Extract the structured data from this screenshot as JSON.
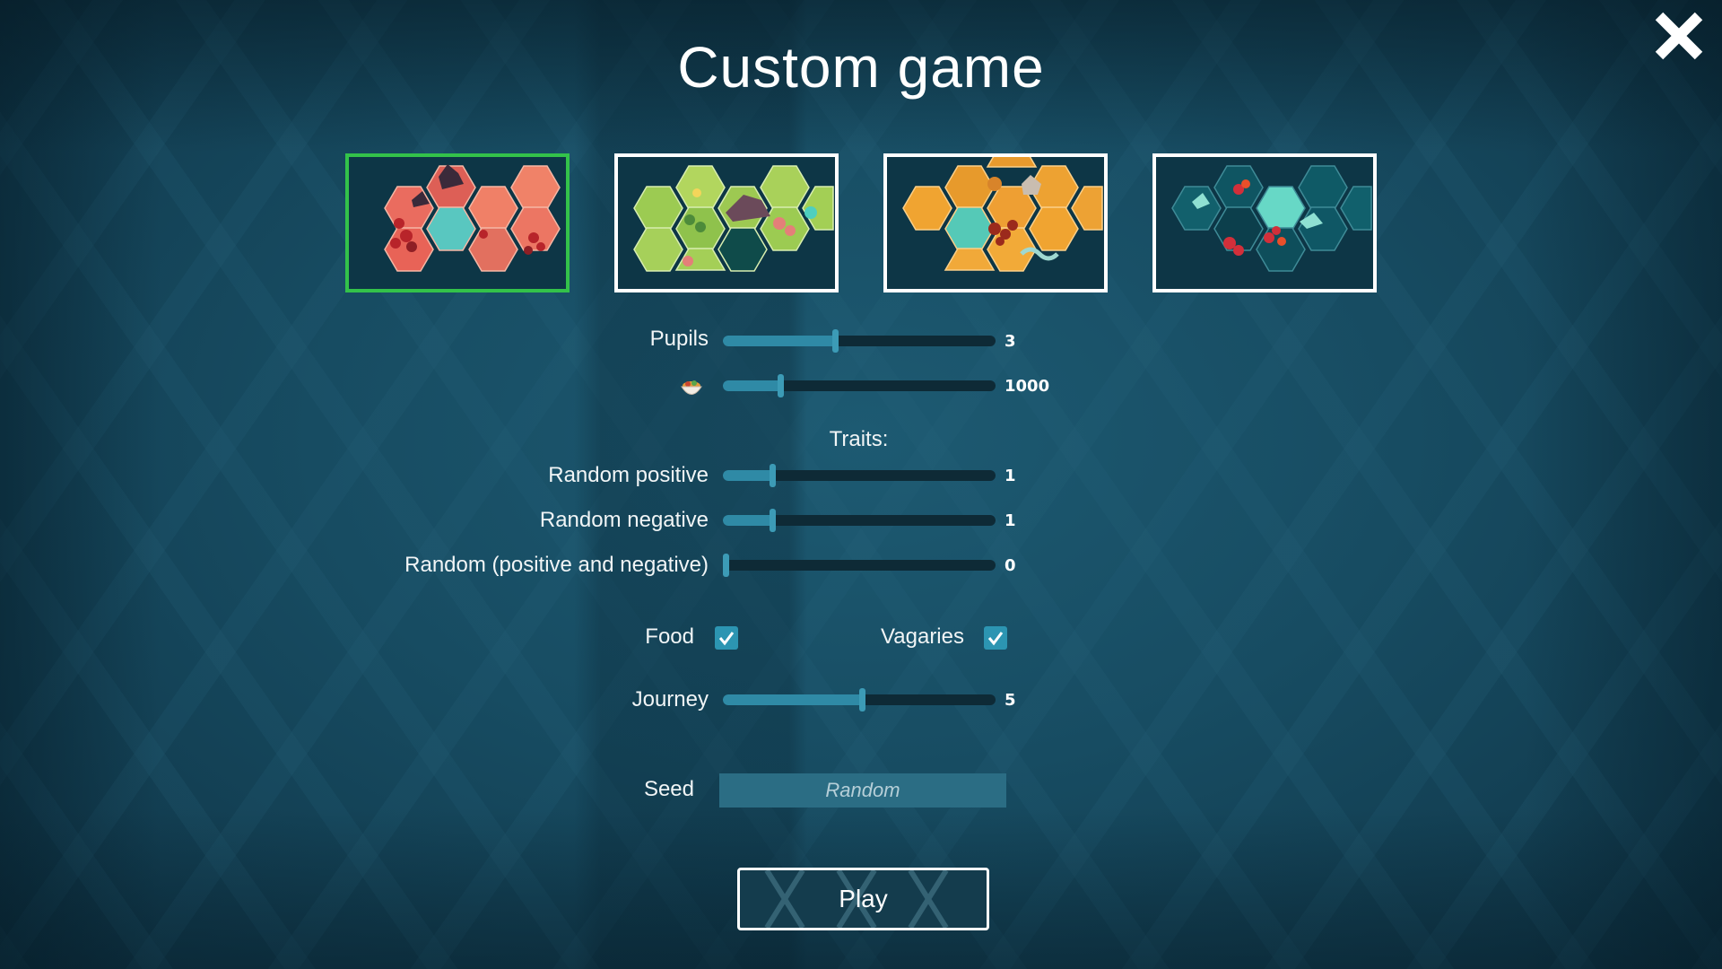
{
  "title": "Custom game",
  "close_icon": "close-icon",
  "maps": [
    {
      "name": "autumn-red-map",
      "selected": true,
      "palette": "#e8685a"
    },
    {
      "name": "green-meadow-map",
      "selected": false,
      "palette": "#9ccb52"
    },
    {
      "name": "orange-desert-map",
      "selected": false,
      "palette": "#f0a431"
    },
    {
      "name": "teal-ocean-map",
      "selected": false,
      "palette": "#0f5e6e"
    }
  ],
  "sliders": {
    "pupils": {
      "label": "Pupils",
      "value": "3",
      "fraction": 0.41
    },
    "food_amount": {
      "icon": "food-bowl-icon",
      "value": "1000",
      "fraction": 0.21
    },
    "traits_heading": "Traits:",
    "random_positive": {
      "label": "Random positive",
      "value": "1",
      "fraction": 0.18
    },
    "random_negative": {
      "label": "Random negative",
      "value": "1",
      "fraction": 0.18
    },
    "random_mixed": {
      "label": "Random (positive and negative)",
      "value": "0",
      "fraction": 0.0
    },
    "journey": {
      "label": "Journey",
      "value": "5",
      "fraction": 0.51
    }
  },
  "toggles": {
    "food": {
      "label": "Food",
      "checked": true
    },
    "vagaries": {
      "label": "Vagaries",
      "checked": true
    }
  },
  "seed": {
    "label": "Seed",
    "placeholder": "Random"
  },
  "play_label": "Play",
  "colors": {
    "selected_border": "#33c24a",
    "accent": "#2f8aa6"
  }
}
